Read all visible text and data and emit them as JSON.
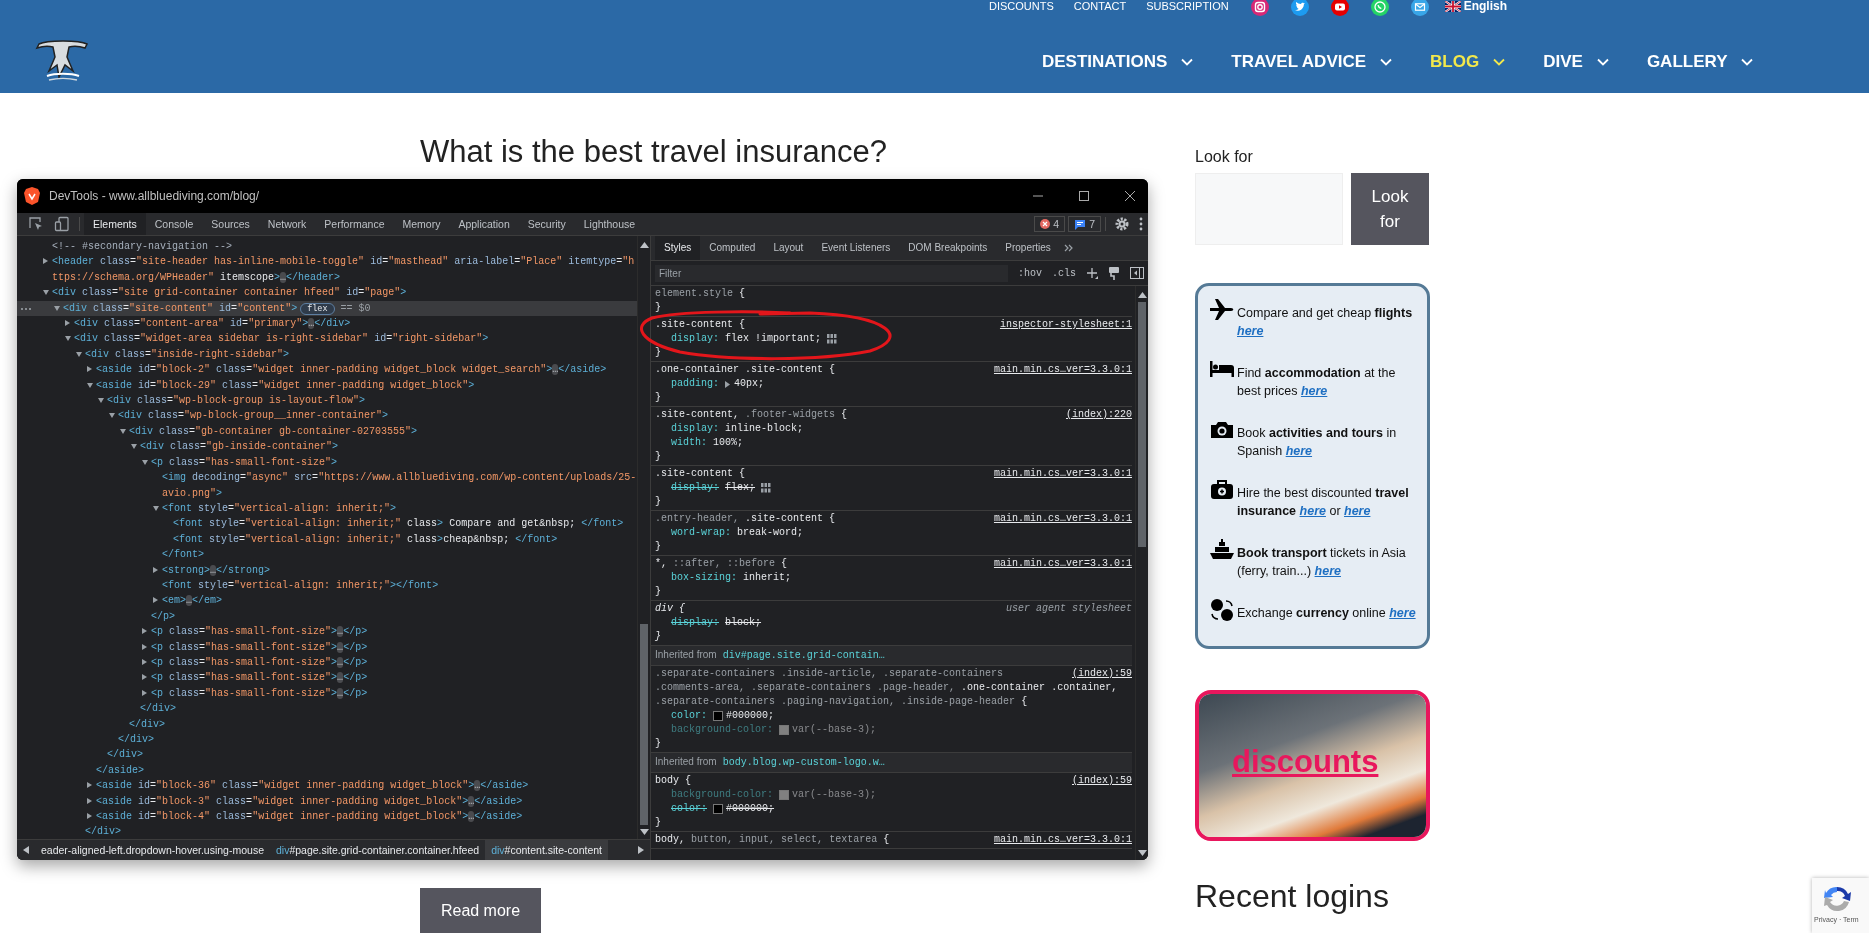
{
  "header": {
    "top_links": [
      {
        "label": "DISCOUNTS"
      },
      {
        "label": "CONTACT"
      },
      {
        "label": "SUBSCRIPTION"
      }
    ],
    "social": [
      {
        "kind": "camera"
      },
      {
        "kind": "bird"
      },
      {
        "kind": "play"
      },
      {
        "kind": "phone"
      },
      {
        "kind": "mail"
      }
    ],
    "language": {
      "label": "English"
    },
    "nav": [
      {
        "label": "DESTINATIONS",
        "selected": false
      },
      {
        "label": "TRAVEL ADVICE",
        "selected": false
      },
      {
        "label": "BLOG",
        "selected": true
      },
      {
        "label": "DIVE",
        "selected": false
      },
      {
        "label": "GALLERY",
        "selected": false
      }
    ]
  },
  "article": {
    "title": "What is the best travel insurance?",
    "read_more": "Read more"
  },
  "devtools": {
    "title": "DevTools - www.allbluediving.com/blog/",
    "tabs": [
      {
        "label": "Elements",
        "selected": true
      },
      {
        "label": "Console",
        "selected": false
      },
      {
        "label": "Sources",
        "selected": false
      },
      {
        "label": "Network",
        "selected": false
      },
      {
        "label": "Performance",
        "selected": false
      },
      {
        "label": "Memory",
        "selected": false
      },
      {
        "label": "Application",
        "selected": false
      },
      {
        "label": "Security",
        "selected": false
      },
      {
        "label": "Lighthouse",
        "selected": false
      }
    ],
    "errors": "4",
    "messages": "7",
    "dom": [
      {
        "kind": "leaf",
        "text": "<!-- #secondary-navigation -->",
        "selected": false
      },
      {
        "kind": "collapsible",
        "expanded": false,
        "selected": false,
        "text": "<header class=\"site-header has-inline-mobile-toggle\" id=\"masthead\" aria-label=\"Place\" itemtype=\"https://schema.org/WPHeader\" itemscope>…</header>"
      },
      {
        "kind": "collapsible",
        "expanded": true,
        "selected": false,
        "text": "<div class=\"site grid-container container hfeed\" id=\"page\">",
        "children": [
          {
            "kind": "collapsible",
            "expanded": true,
            "selected": true,
            "text": "<div class=\"site-content\" id=\"content\">",
            "badge": "flex",
            "console_ref": "== $0",
            "children": [
              {
                "kind": "collapsible",
                "expanded": false,
                "selected": false,
                "text": "<div class=\"content-area\" id=\"primary\">…</div>"
              },
              {
                "kind": "collapsible",
                "expanded": true,
                "selected": false,
                "text": "<div class=\"widget-area sidebar is-right-sidebar\" id=\"right-sidebar\">",
                "children": [
                  {
                    "kind": "collapsible",
                    "expanded": true,
                    "selected": false,
                    "text": "<div class=\"inside-right-sidebar\">",
                    "close": "</div>",
                    "children": [
                      {
                        "kind": "collapsible",
                        "expanded": false,
                        "selected": false,
                        "text": "<aside id=\"block-2\" class=\"widget inner-padding widget_block widget_search\">…</aside>"
                      },
                      {
                        "kind": "collapsible",
                        "expanded": true,
                        "selected": false,
                        "text": "<aside id=\"block-29\" class=\"widget inner-padding widget_block\">",
                        "close": "</aside>",
                        "children": [
                          {
                            "kind": "collapsible",
                            "expanded": true,
                            "selected": false,
                            "text": "<div class=\"wp-block-group is-layout-flow\">",
                            "close": "</div>",
                            "children": [
                              {
                                "kind": "collapsible",
                                "expanded": true,
                                "selected": false,
                                "text": "<div class=\"wp-block-group__inner-container\">",
                                "close": "</div>",
                                "children": [
                                  {
                                    "kind": "collapsible",
                                    "expanded": true,
                                    "selected": false,
                                    "text": "<div class=\"gb-container gb-container-02703555\">",
                                    "close": "</div>",
                                    "children": [
                                      {
                                        "kind": "collapsible",
                                        "expanded": true,
                                        "selected": false,
                                        "text": "<div class=\"gb-inside-container\">",
                                        "close": "</div>",
                                        "children": [
                                          {
                                            "kind": "collapsible",
                                            "expanded": true,
                                            "selected": false,
                                            "text": "<p class=\"has-small-font-size\">",
                                            "close": "</p>",
                                            "children": [
                                              {
                                                "kind": "leaf",
                                                "selected": false,
                                                "text": "<img decoding=\"async\" src=\"https://www.allbluediving.com/wp-content/uploads/25-avio.png\">"
                                              },
                                              {
                                                "kind": "collapsible",
                                                "expanded": true,
                                                "selected": false,
                                                "text": "<font style=\"vertical-align: inherit;\">",
                                                "close": "</font>",
                                                "children": [
                                                  {
                                                    "kind": "leaf",
                                                    "selected": false,
                                                    "text": "<font style=\"vertical-align: inherit;\" class> Compare and get&nbsp; </font>"
                                                  },
                                                  {
                                                    "kind": "leaf",
                                                    "selected": false,
                                                    "text": "<font style=\"vertical-align: inherit;\" class>cheap&nbsp; </font>"
                                                  }
                                                ]
                                              },
                                              {
                                                "kind": "collapsible",
                                                "expanded": false,
                                                "selected": false,
                                                "text": "<strong>…</strong>"
                                              },
                                              {
                                                "kind": "leaf",
                                                "selected": false,
                                                "text": "<font style=\"vertical-align: inherit;\"></font>"
                                              },
                                              {
                                                "kind": "collapsible",
                                                "expanded": false,
                                                "selected": false,
                                                "text": "<em>…</em>"
                                              }
                                            ]
                                          },
                                          {
                                            "kind": "collapsible",
                                            "expanded": false,
                                            "selected": false,
                                            "text": "<p class=\"has-small-font-size\">…</p>"
                                          },
                                          {
                                            "kind": "collapsible",
                                            "expanded": false,
                                            "selected": false,
                                            "text": "<p class=\"has-small-font-size\">…</p>"
                                          },
                                          {
                                            "kind": "collapsible",
                                            "expanded": false,
                                            "selected": false,
                                            "text": "<p class=\"has-small-font-size\">…</p>"
                                          },
                                          {
                                            "kind": "collapsible",
                                            "expanded": false,
                                            "selected": false,
                                            "text": "<p class=\"has-small-font-size\">…</p>"
                                          },
                                          {
                                            "kind": "collapsible",
                                            "expanded": false,
                                            "selected": false,
                                            "text": "<p class=\"has-small-font-size\">…</p>"
                                          }
                                        ]
                                      }
                                    ]
                                  }
                                ]
                              }
                            ]
                          }
                        ]
                      },
                      {
                        "kind": "collapsible",
                        "expanded": false,
                        "selected": false,
                        "text": "<aside id=\"block-36\" class=\"widget inner-padding widget_block\">…</aside>"
                      },
                      {
                        "kind": "collapsible",
                        "expanded": false,
                        "selected": false,
                        "text": "<aside id=\"block-3\" class=\"widget inner-padding widget_block\">…</aside>"
                      },
                      {
                        "kind": "collapsible",
                        "expanded": false,
                        "selected": false,
                        "text": "<aside id=\"block-4\" class=\"widget inner-padding widget_block\">…</aside>"
                      }
                    ]
                  }
                ]
              }
            ]
          }
        ]
      }
    ],
    "breadcrumbs": [
      {
        "rest": "eader-aligned-left.dropdown-hover.using-mouse",
        "selected": false
      },
      {
        "tag": "div",
        "rest": "#page.site.grid-container.container.hfeed",
        "selected": false
      },
      {
        "tag": "div",
        "rest": "#content.site-content",
        "selected": true
      }
    ],
    "styles_tabs": [
      {
        "label": "Styles",
        "selected": true
      },
      {
        "label": "Computed",
        "selected": false
      },
      {
        "label": "Layout",
        "selected": false
      },
      {
        "label": "Event Listeners",
        "selected": false
      },
      {
        "label": "DOM Breakpoints",
        "selected": false
      },
      {
        "label": "Properties",
        "selected": false
      }
    ],
    "filter": {
      "placeholder": "Filter"
    },
    "hov": ":hov",
    "cls": ".cls",
    "rules": [
      {
        "kind": "rule",
        "selector": [
          {
            "text": "element.style",
            "matched": false
          }
        ],
        "open": "{",
        "close": "}"
      },
      {
        "kind": "rule",
        "selector": [
          {
            "text": ".site-content",
            "matched": true
          }
        ],
        "open": "{",
        "close": "}",
        "source": "inspector-stylesheet:1",
        "props": [
          {
            "name": "display:",
            "value": "flex !important;",
            "overridden": false,
            "inactive": false,
            "flex_editor": true
          }
        ]
      },
      {
        "kind": "rule",
        "selector": [
          {
            "text": ".one-container .site-content",
            "matched": true
          }
        ],
        "open": "{",
        "close": "}",
        "source": "main.min.cs…ver=3.3.0:1",
        "props": [
          {
            "name": "padding:",
            "value": "40px;",
            "overridden": false,
            "inactive": false,
            "expandable": true
          }
        ]
      },
      {
        "kind": "rule",
        "selector": [
          {
            "text": ".site-content,",
            "matched": true
          },
          {
            "text": ".footer-widgets",
            "matched": false
          }
        ],
        "open": "{",
        "close": "}",
        "source": "(index):220",
        "props": [
          {
            "name": "display:",
            "value": "inline-block;",
            "overridden": false,
            "inactive": false
          },
          {
            "name": "width:",
            "value": "100%;",
            "overridden": false,
            "inactive": false
          }
        ]
      },
      {
        "kind": "rule",
        "selector": [
          {
            "text": ".site-content",
            "matched": true
          }
        ],
        "open": "{",
        "close": "}",
        "source": "main.min.cs…ver=3.3.0:1",
        "props": [
          {
            "name": "display:",
            "value": "flex;",
            "overridden": true,
            "inactive": false,
            "flex_editor": true
          }
        ]
      },
      {
        "kind": "rule",
        "selector": [
          {
            "text": ".entry-header,",
            "matched": false
          },
          {
            "text": ".site-content",
            "matched": true
          }
        ],
        "open": "{",
        "close": "}",
        "source": "main.min.cs…ver=3.3.0:1",
        "props": [
          {
            "name": "word-wrap:",
            "value": "break-word;",
            "overridden": false,
            "inactive": false
          }
        ]
      },
      {
        "kind": "rule",
        "selector": [
          {
            "text": "*,",
            "matched": true
          },
          {
            "text": "::after,",
            "matched": false
          },
          {
            "text": "::before",
            "matched": false
          }
        ],
        "open": "{",
        "close": "}",
        "source": "main.min.cs…ver=3.3.0:1",
        "props": [
          {
            "name": "box-sizing:",
            "value": "inherit;",
            "overridden": false,
            "inactive": false
          }
        ]
      },
      {
        "kind": "user-agent",
        "selector": [
          {
            "text": "div",
            "matched": true
          }
        ],
        "open": "{",
        "close": "}",
        "source": "user agent stylesheet",
        "props": [
          {
            "name": "display:",
            "value": "block;",
            "overridden": true,
            "inactive": false
          }
        ]
      },
      {
        "kind": "inherited",
        "label": "Inherited from",
        "target": "div#page.site.grid-contain…"
      },
      {
        "kind": "rule",
        "selector": [
          {
            "text": ".separate-containers",
            "matched": false
          },
          {
            "text": ".inside-article,",
            "matched": false
          },
          {
            "text": ".separate-containers",
            "matched": false
          },
          {
            "text": ".comments-area,",
            "matched": false
          },
          {
            "text": ".separate-containers",
            "matched": false
          },
          {
            "text": ".page-header,",
            "matched": false
          },
          {
            "text": ".one-container",
            "matched": true
          },
          {
            "text": ".container,",
            "matched": true
          },
          {
            "text": ".separate-containers",
            "matched": false
          },
          {
            "text": ".paging-navigation,",
            "matched": false
          },
          {
            "text": ".inside-page-header",
            "matched": false
          }
        ],
        "open": "{",
        "close": "}",
        "source": "(index):59",
        "props": [
          {
            "name": "color:",
            "value": "#000000;",
            "overridden": false,
            "inactive": false,
            "color": "#000000"
          },
          {
            "name": "background-color:",
            "value": "var(--base-3);",
            "overridden": false,
            "inactive": true,
            "color": "#808080"
          }
        ]
      },
      {
        "kind": "inherited",
        "label": "Inherited from",
        "target": "body.blog.wp-custom-logo.w…"
      },
      {
        "kind": "rule",
        "selector": [
          {
            "text": "body",
            "matched": true
          }
        ],
        "open": "{",
        "close": "}",
        "source": "(index):59",
        "props": [
          {
            "name": "background-color:",
            "value": "var(--base-3);",
            "overridden": false,
            "inactive": true,
            "color": "#808080"
          },
          {
            "name": "color:",
            "value": "#000000;",
            "overridden": true,
            "inactive": false,
            "color": "#000000"
          }
        ]
      },
      {
        "kind": "rule",
        "selector": [
          {
            "text": "body,",
            "matched": true
          },
          {
            "text": "button,",
            "matched": false
          },
          {
            "text": "input,",
            "matched": false
          },
          {
            "text": "select,",
            "matched": false
          },
          {
            "text": "textarea",
            "matched": false
          }
        ],
        "open": "{",
        "source": "main.min.cs…ver=3.3.0:1"
      }
    ]
  },
  "sidebar": {
    "search_label": "Look for",
    "search_button": "Look for",
    "promo": [
      {
        "kind": "plane",
        "parts": [
          {
            "kind": "text",
            "text": "Compare and get cheap **flights** "
          },
          {
            "kind": "link",
            "text": "here"
          }
        ]
      },
      {
        "kind": "bed",
        "parts": [
          {
            "kind": "text",
            "text": "Find **accommodation** at the best prices "
          },
          {
            "kind": "link",
            "text": "here"
          }
        ]
      },
      {
        "kind": "camera",
        "parts": [
          {
            "kind": "text",
            "text": "Book **activities and tours** in Spanish "
          },
          {
            "kind": "link",
            "text": "here"
          }
        ]
      },
      {
        "kind": "case",
        "parts": [
          {
            "kind": "text",
            "text": "Hire the best discounted **travel insurance** "
          },
          {
            "kind": "link",
            "text": "here"
          },
          {
            "kind": "text",
            "text": " or "
          },
          {
            "kind": "link",
            "text": "here"
          }
        ]
      },
      {
        "kind": "ship",
        "parts": [
          {
            "kind": "text",
            "text": "**Book transport** tickets in Asia (ferry, train...) "
          },
          {
            "kind": "link",
            "text": "here"
          }
        ]
      },
      {
        "kind": "currency",
        "parts": [
          {
            "kind": "text",
            "text": "Exchange **currency** online "
          },
          {
            "kind": "link",
            "text": "here"
          }
        ]
      }
    ],
    "banner": {
      "label": "discounts"
    },
    "recent_heading": "Recent logins"
  },
  "recaptcha": {
    "text": "Privacy · Term"
  }
}
